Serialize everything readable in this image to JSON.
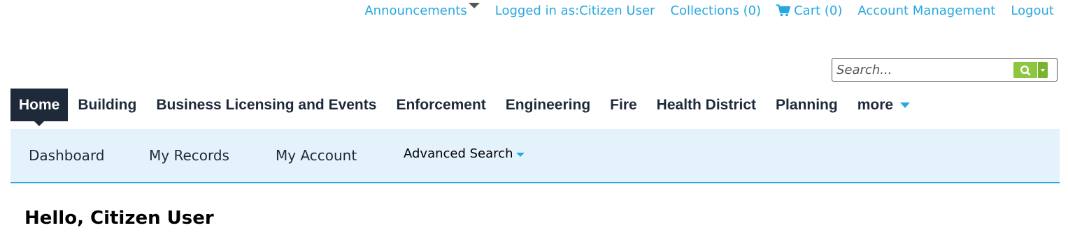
{
  "top_links": {
    "announcements": "Announcements",
    "logged_in": "Logged in as:Citizen User",
    "collections": "Collections (0)",
    "cart": "Cart (0)",
    "account_management": "Account Management",
    "logout": "Logout"
  },
  "search": {
    "placeholder": "Search...",
    "value": "",
    "button_color": "#8dc63f"
  },
  "main_nav": {
    "items": [
      {
        "label": "Home",
        "active": true
      },
      {
        "label": "Building"
      },
      {
        "label": "Business Licensing and Events"
      },
      {
        "label": "Enforcement"
      },
      {
        "label": "Engineering"
      },
      {
        "label": "Fire"
      },
      {
        "label": "Health District"
      },
      {
        "label": "Planning"
      },
      {
        "label": "more"
      }
    ]
  },
  "sub_nav": {
    "dashboard": "Dashboard",
    "my_records": "My Records",
    "my_account": "My Account",
    "advanced_search": "Advanced Search"
  },
  "greeting": "Hello, Citizen User",
  "colors": {
    "link": "#29a8e0",
    "nav_active_bg": "#1e2a3a",
    "subnav_bg": "#e4f3fb",
    "subnav_border": "#29a8e0"
  },
  "icons": {
    "announcements_caret": "caret-down-icon",
    "cart": "cart-icon",
    "search": "search-icon",
    "search_dropdown": "chevron-down-icon",
    "more": "caret-down-icon",
    "advanced_search": "caret-down-icon"
  }
}
